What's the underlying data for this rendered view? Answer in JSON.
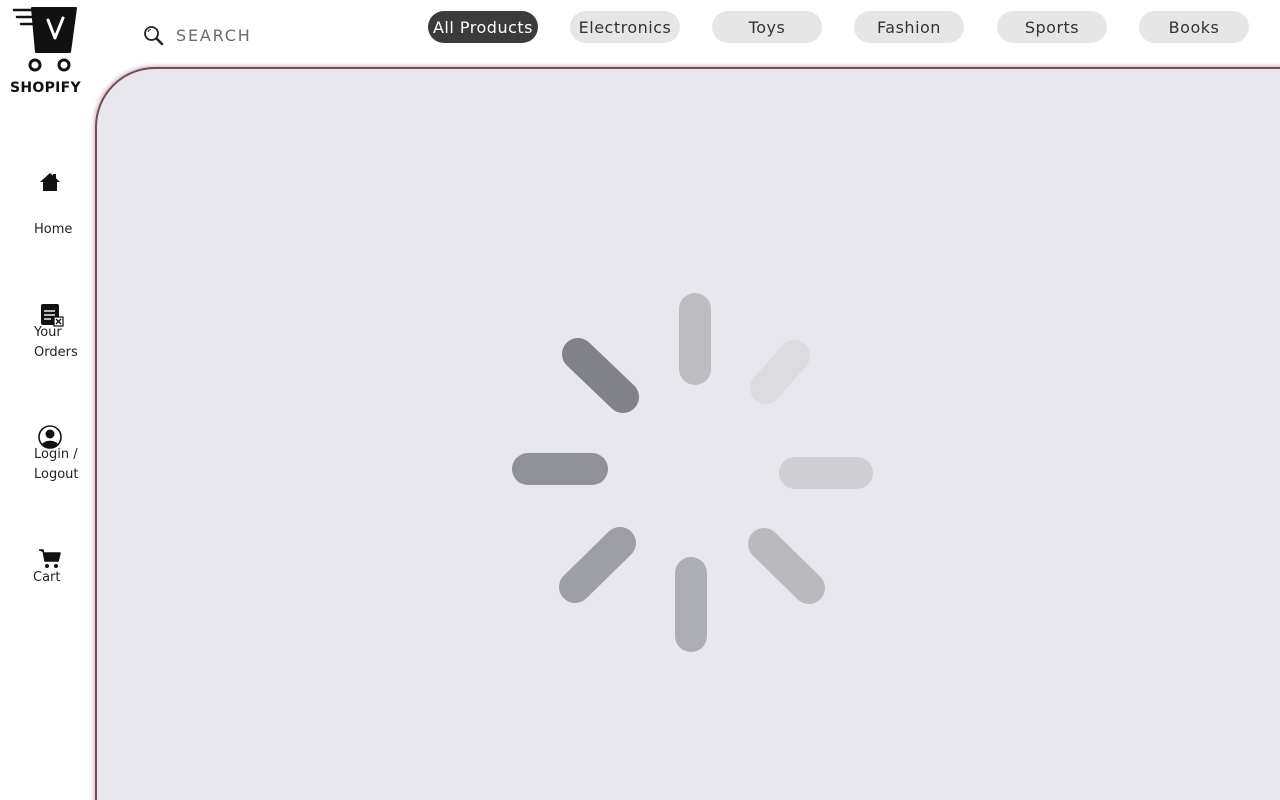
{
  "brand": {
    "name": "SHOPIFY"
  },
  "search": {
    "placeholder": "SEARCH",
    "icon": "search-icon"
  },
  "categories": [
    {
      "label": "All Products",
      "active": true
    },
    {
      "label": "Electronics",
      "active": false
    },
    {
      "label": "Toys",
      "active": false
    },
    {
      "label": "Fashion",
      "active": false
    },
    {
      "label": "Sports",
      "active": false
    },
    {
      "label": "Books",
      "active": false
    }
  ],
  "sidebar": {
    "items": [
      {
        "label": "Home",
        "icon": "home-icon"
      },
      {
        "label_line1": "Your",
        "label_line2": "Orders",
        "icon": "orders-icon"
      },
      {
        "label_line1": "Login /",
        "label_line2": "Logout",
        "icon": "user-icon"
      },
      {
        "label": "Cart",
        "icon": "cart-icon"
      }
    ]
  },
  "colors": {
    "active_pill": "#3b3b3b",
    "pill": "#e6e6e6",
    "main_bg": "#e8e7ee",
    "main_border": "#7a4a55"
  }
}
